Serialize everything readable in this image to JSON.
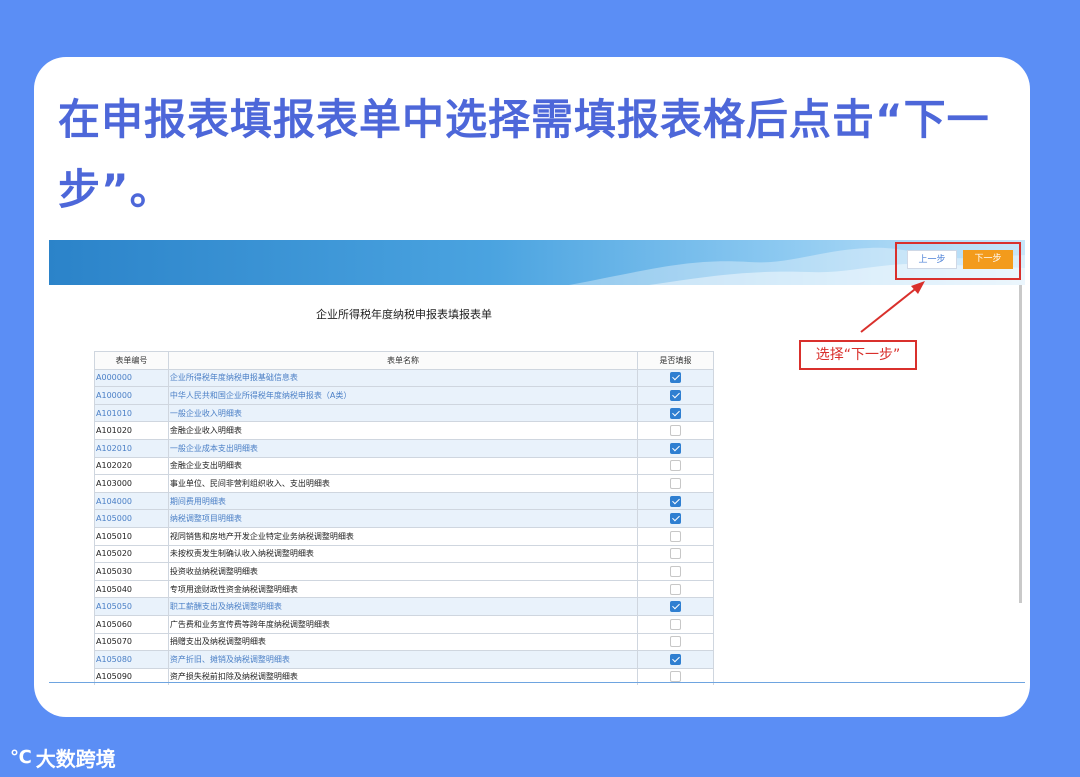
{
  "headline": "在申报表填报表单中选择需填报表格后点击“下一步”。",
  "toolbar": {
    "prev_label": "上一步",
    "next_label": "下一步"
  },
  "form": {
    "title": "企业所得税年度纳税申报表填报表单",
    "headers": [
      "表单编号",
      "表单名称",
      "是否填报"
    ],
    "rows": [
      {
        "code": "A000000",
        "name": "企业所得税年度纳税申报基础信息表",
        "checked": true
      },
      {
        "code": "A100000",
        "name": "中华人民共和国企业所得税年度纳税申报表（A类）",
        "checked": true
      },
      {
        "code": "A101010",
        "name": "一般企业收入明细表",
        "checked": true
      },
      {
        "code": "A101020",
        "name": "金融企业收入明细表",
        "checked": false
      },
      {
        "code": "A102010",
        "name": "一般企业成本支出明细表",
        "checked": true
      },
      {
        "code": "A102020",
        "name": "金融企业支出明细表",
        "checked": false
      },
      {
        "code": "A103000",
        "name": "事业单位、民间非营利组织收入、支出明细表",
        "checked": false
      },
      {
        "code": "A104000",
        "name": "期间费用明细表",
        "checked": true
      },
      {
        "code": "A105000",
        "name": "纳税调整项目明细表",
        "checked": true
      },
      {
        "code": "A105010",
        "name": "视同销售和房地产开发企业特定业务纳税调整明细表",
        "checked": false
      },
      {
        "code": "A105020",
        "name": "未按权责发生制确认收入纳税调整明细表",
        "checked": false
      },
      {
        "code": "A105030",
        "name": "投资收益纳税调整明细表",
        "checked": false
      },
      {
        "code": "A105040",
        "name": "专项用途财政性资金纳税调整明细表",
        "checked": false
      },
      {
        "code": "A105050",
        "name": "职工薪酬支出及纳税调整明细表",
        "checked": true
      },
      {
        "code": "A105060",
        "name": "广告费和业务宣传费等跨年度纳税调整明细表",
        "checked": false
      },
      {
        "code": "A105070",
        "name": "捐赠支出及纳税调整明细表",
        "checked": false
      },
      {
        "code": "A105080",
        "name": "资产折旧、摊销及纳税调整明细表",
        "checked": true
      },
      {
        "code": "A105090",
        "name": "资产损失税前扣除及纳税调整明细表",
        "checked": false
      }
    ]
  },
  "callout": "选择“下一步”",
  "brand": {
    "logo": "℃",
    "name": "大数跨境"
  },
  "colors": {
    "background": "#5b8ef5",
    "headline": "#4d67d9",
    "annotation": "#d9302c",
    "next_button": "#f39b1c",
    "checkbox": "#2f7fd1"
  }
}
